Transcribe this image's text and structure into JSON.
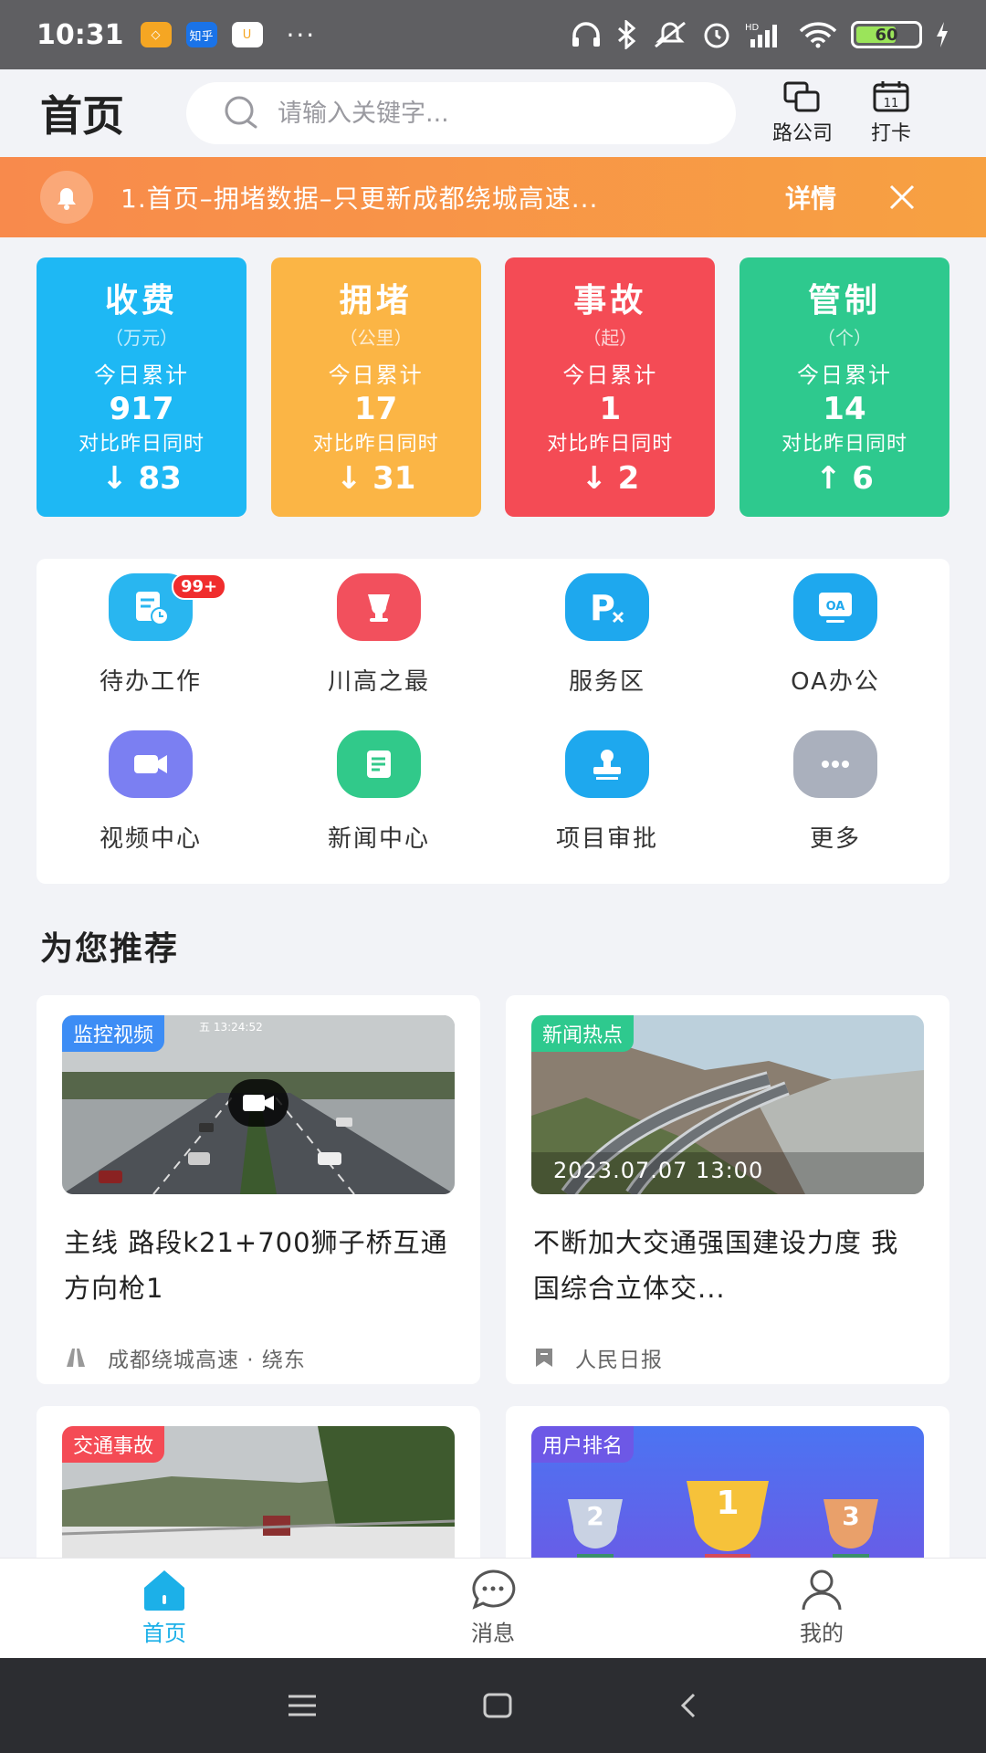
{
  "status_bar": {
    "time": "10:31",
    "battery": "60",
    "app_zhihu": "知乎",
    "more": "···"
  },
  "header": {
    "title": "首页",
    "search_placeholder": "请输入关键字...",
    "company_label": "路公司",
    "clock_in_label": "打卡",
    "clock_day": "11"
  },
  "notice": {
    "text": "1.首页–拥堵数据–只更新成都绕城高速...",
    "detail_label": "详情"
  },
  "stats": [
    {
      "title": "收费",
      "unit": "（万元）",
      "today_label": "今日累计",
      "value": "917",
      "compare_label": "对比昨日同时",
      "diff": "↓ 83",
      "color": "#1eb8f4"
    },
    {
      "title": "拥堵",
      "unit": "（公里）",
      "today_label": "今日累计",
      "value": "17",
      "compare_label": "对比昨日同时",
      "diff": "↓ 31",
      "color": "#fbb545"
    },
    {
      "title": "事故",
      "unit": "（起）",
      "today_label": "今日累计",
      "value": "1",
      "compare_label": "对比昨日同时",
      "diff": "↓ 2",
      "color": "#f44b55"
    },
    {
      "title": "管制",
      "unit": "（个）",
      "today_label": "今日累计",
      "value": "14",
      "compare_label": "对比昨日同时",
      "diff": "↑ 6",
      "color": "#2ec98e"
    }
  ],
  "shortcuts": [
    {
      "label": "待办工作",
      "icon": "todo-icon",
      "badge": "99+"
    },
    {
      "label": "川高之最",
      "icon": "trophy-icon"
    },
    {
      "label": "服务区",
      "icon": "service-area-icon"
    },
    {
      "label": "OA办公",
      "icon": "oa-icon",
      "icon_text": "OA"
    },
    {
      "label": "视频中心",
      "icon": "video-icon"
    },
    {
      "label": "新闻中心",
      "icon": "news-icon"
    },
    {
      "label": "项目审批",
      "icon": "stamp-icon"
    },
    {
      "label": "更多",
      "icon": "more-icon"
    }
  ],
  "recommend": {
    "title": "为您推荐",
    "cards": [
      {
        "tag": "监控视频",
        "tag_color": "#3d8df5",
        "cam_overlay": "五 13:24:52",
        "title": "主线 路段k21+700狮子桥互通方向枪1",
        "source": "成都绕城高速 · 绕东"
      },
      {
        "tag": "新闻热点",
        "tag_color": "#2ec98e",
        "date": "2023.07.07 13:00",
        "title": "不断加大交通强国建设力度 我国综合立体交...",
        "source": "人民日报"
      },
      {
        "tag": "交通事故",
        "tag_color": "#f44b55"
      },
      {
        "tag": "用户排名",
        "tag_color": "#6d58e6",
        "ranks": [
          "2",
          "1",
          "3"
        ]
      }
    ]
  },
  "tabbar": [
    {
      "label": "首页",
      "active": true
    },
    {
      "label": "消息",
      "active": false
    },
    {
      "label": "我的",
      "active": false
    }
  ]
}
